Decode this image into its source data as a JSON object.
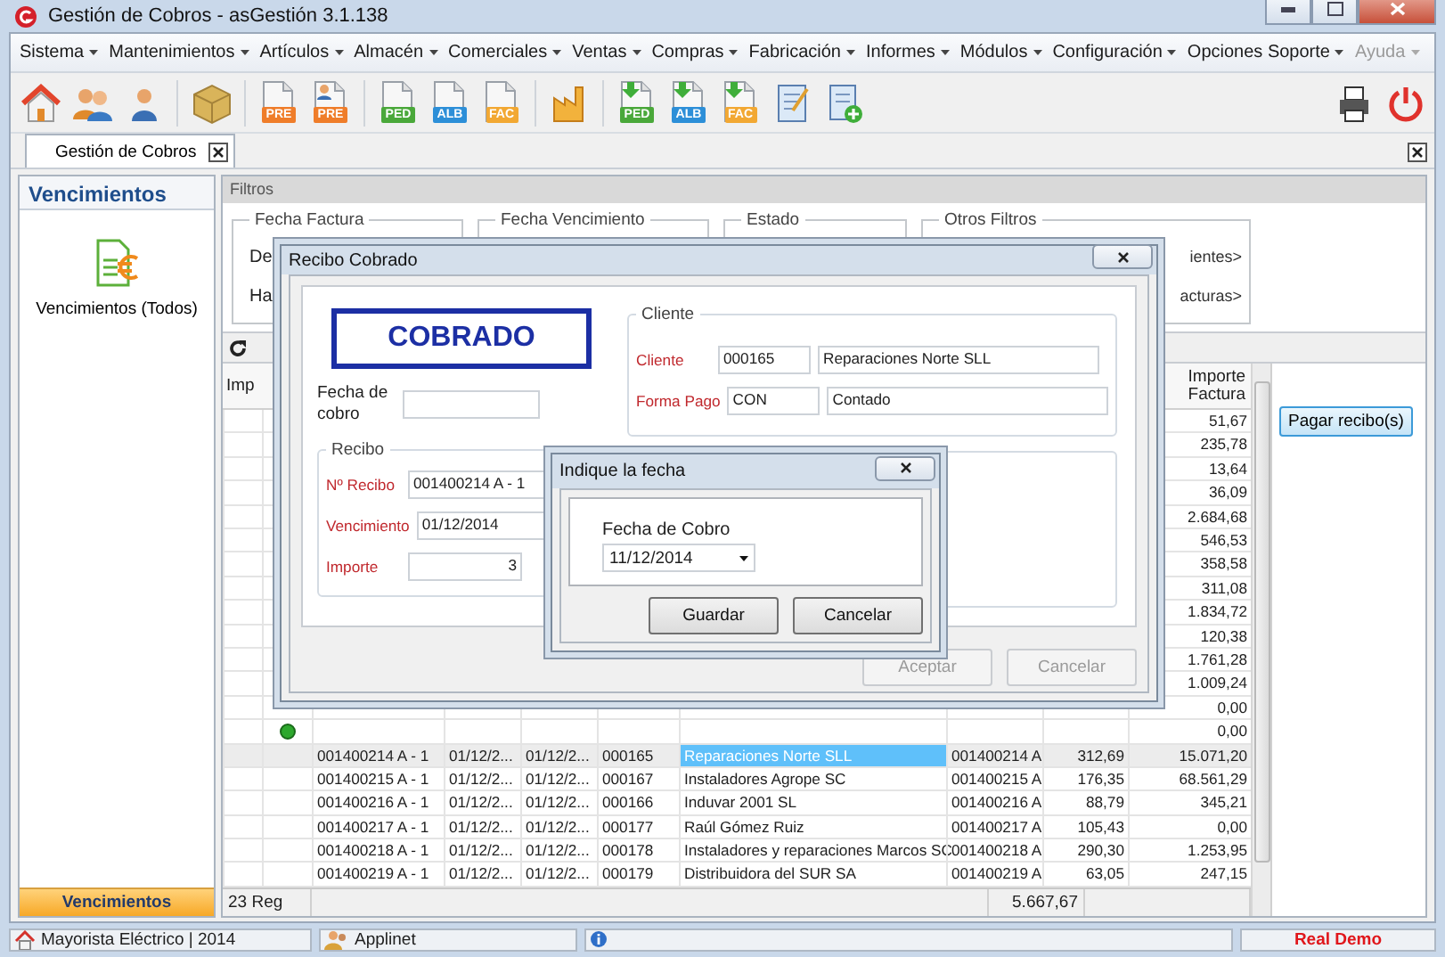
{
  "window": {
    "title": "Gestión de Cobros - asGestión 3.1.138"
  },
  "menu": [
    {
      "label": "Sistema",
      "disabled": false
    },
    {
      "label": "Mantenimientos",
      "disabled": false
    },
    {
      "label": "Artículos",
      "disabled": false
    },
    {
      "label": "Almacén",
      "disabled": false
    },
    {
      "label": "Comerciales",
      "disabled": false
    },
    {
      "label": "Ventas",
      "disabled": false
    },
    {
      "label": "Compras",
      "disabled": false
    },
    {
      "label": "Fabricación",
      "disabled": false
    },
    {
      "label": "Informes",
      "disabled": false
    },
    {
      "label": "Módulos",
      "disabled": false
    },
    {
      "label": "Configuración",
      "disabled": false
    },
    {
      "label": "Opciones Soporte",
      "disabled": false
    },
    {
      "label": "Ayuda",
      "disabled": true
    }
  ],
  "toolbar_documents": [
    {
      "kind": "plain",
      "label": "PRE",
      "color": "#ef7d2a"
    },
    {
      "kind": "person",
      "label": "PRE",
      "color": "#ef7d2a"
    },
    {
      "kind": "plain",
      "label": "PED",
      "color": "#4aa83a"
    },
    {
      "kind": "plain",
      "label": "ALB",
      "color": "#2d8fd8"
    },
    {
      "kind": "plain",
      "label": "FAC",
      "color": "#f2a833"
    },
    {
      "kind": "arrow",
      "label": "PED",
      "color": "#4aa83a"
    },
    {
      "kind": "arrow",
      "label": "ALB",
      "color": "#2d8fd8"
    },
    {
      "kind": "arrow",
      "label": "FAC",
      "color": "#f2a833"
    }
  ],
  "tabs": [
    {
      "label": "Gestión de Cobros",
      "selected": true
    }
  ],
  "sidebar": {
    "title": "Vencimientos",
    "items": [
      {
        "label": "Vencimientos (Todos)"
      }
    ],
    "footer_button": "Vencimientos"
  },
  "filters": {
    "title": "Filtros",
    "groups": [
      {
        "legend": "Fecha Factura",
        "labels": [
          "De",
          "Ha"
        ]
      },
      {
        "legend": "Fecha Vencimiento"
      },
      {
        "legend": "Estado"
      },
      {
        "legend": "Otros Filtros",
        "links": [
          "ientes>",
          "acturas>"
        ]
      }
    ]
  },
  "table": {
    "header_left": "Imp",
    "header_right": "Importe Factura",
    "partial_rows": [
      {
        "importe_factura": "51,67",
        "paid": false
      },
      {
        "importe_factura": "235,78",
        "paid": false
      },
      {
        "importe_factura": "13,64",
        "paid": false
      },
      {
        "importe_factura": "36,09",
        "paid": false
      },
      {
        "importe_factura": "2.684,68",
        "paid": false
      },
      {
        "importe_factura": "546,53",
        "paid": false
      },
      {
        "importe_factura": "358,58",
        "paid": false
      },
      {
        "importe_factura": "311,08",
        "paid": false
      },
      {
        "importe_factura": "1.834,72",
        "paid": false
      },
      {
        "importe_factura": "120,38",
        "paid": false
      },
      {
        "importe_factura": "1.761,28",
        "paid": false
      },
      {
        "importe_factura": "1.009,24",
        "paid": false
      },
      {
        "importe_factura": "0,00",
        "paid": false
      },
      {
        "importe_factura": "0,00",
        "paid": true
      }
    ],
    "rows": [
      {
        "selected": true,
        "cells": [
          "001400214 A - 1",
          "01/12/2...",
          "01/12/2...",
          "000165",
          "Reparaciones Norte SLL",
          "001400214 A",
          "312,69",
          "15.071,20"
        ]
      },
      {
        "selected": false,
        "cells": [
          "001400215 A - 1",
          "01/12/2...",
          "01/12/2...",
          "000167",
          "Instaladores Agrope SC",
          "001400215 A",
          "176,35",
          "68.561,29"
        ]
      },
      {
        "selected": false,
        "cells": [
          "001400216 A - 1",
          "01/12/2...",
          "01/12/2...",
          "000166",
          "Induvar 2001 SL",
          "001400216 A",
          "88,79",
          "345,21"
        ]
      },
      {
        "selected": false,
        "cells": [
          "001400217 A - 1",
          "01/12/2...",
          "01/12/2...",
          "000177",
          "Raúl Gómez Ruiz",
          "001400217 A",
          "105,43",
          "0,00"
        ]
      },
      {
        "selected": false,
        "cells": [
          "001400218 A - 1",
          "01/12/2...",
          "01/12/2...",
          "000178",
          "Instaladores y reparaciones Marcos SC",
          "001400218 A",
          "290,30",
          "1.253,95"
        ]
      },
      {
        "selected": false,
        "cells": [
          "001400219 A - 1",
          "01/12/2...",
          "01/12/2...",
          "000179",
          "Distribuidora del SUR SA",
          "001400219 A",
          "63,05",
          "247,15"
        ]
      }
    ],
    "footer": {
      "count": "23 Reg",
      "total": "5.667,67"
    }
  },
  "pay_button": "Pagar recibo(s)",
  "receipt_dialog": {
    "title": "Recibo Cobrado",
    "stamp": "COBRADO",
    "payment_date_label": "Fecha de cobro",
    "client_group": {
      "legend": "Cliente",
      "fields": [
        {
          "label": "Cliente",
          "code": "000165",
          "name": "Reparaciones Norte SLL"
        },
        {
          "label": "Forma Pago",
          "code": "CON",
          "name": "Contado"
        }
      ]
    },
    "receipt_group": {
      "legend": "Recibo",
      "fields": [
        {
          "kind": "text",
          "label": "Nº Recibo",
          "value": "001400214 A - 1"
        },
        {
          "kind": "text",
          "label": "Vencimiento",
          "value": "01/12/2014"
        },
        {
          "kind": "amount",
          "label": "Importe",
          "value": "3"
        }
      ]
    },
    "buttons": [
      {
        "label": "Aceptar",
        "disabled": true
      },
      {
        "label": "Cancelar",
        "disabled": true
      }
    ]
  },
  "date_dialog": {
    "title": "Indique la fecha",
    "field_label": "Fecha de Cobro",
    "value": "11/12/2014",
    "buttons": [
      "Guardar",
      "Cancelar"
    ]
  },
  "status_bar": {
    "company": "Mayorista Eléctrico | 2014",
    "user": "Applinet",
    "mode": "Real Demo"
  }
}
